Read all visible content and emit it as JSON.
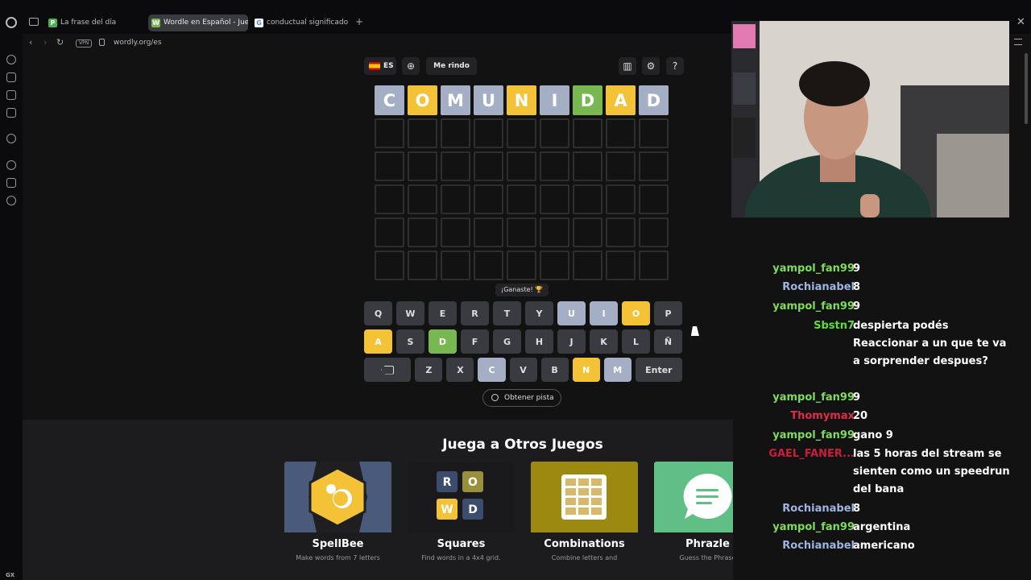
{
  "browser": {
    "tabs": [
      {
        "label": "La frase del día",
        "favicon": "P",
        "favicon_color": "#4caf50"
      },
      {
        "label": "Wordle en Español - Juego",
        "favicon": "W",
        "favicon_color": "#79b851"
      },
      {
        "label": "conductual significado - B",
        "favicon": "G",
        "favicon_color": "#ea4335"
      }
    ],
    "url": "wordly.org/es",
    "vpn_label": "VPN"
  },
  "toolbar": {
    "language": "ES",
    "give_up_label": "Me rindo"
  },
  "board": {
    "rows": [
      [
        {
          "l": "C",
          "s": "absent"
        },
        {
          "l": "O",
          "s": "present"
        },
        {
          "l": "M",
          "s": "absent"
        },
        {
          "l": "U",
          "s": "absent"
        },
        {
          "l": "N",
          "s": "present"
        },
        {
          "l": "I",
          "s": "absent"
        },
        {
          "l": "D",
          "s": "correct"
        },
        {
          "l": "A",
          "s": "present"
        },
        {
          "l": "D",
          "s": "absent"
        }
      ],
      [
        {
          "l": "",
          "s": ""
        },
        {
          "l": "",
          "s": ""
        },
        {
          "l": "",
          "s": ""
        },
        {
          "l": "",
          "s": ""
        },
        {
          "l": "",
          "s": ""
        },
        {
          "l": "",
          "s": ""
        },
        {
          "l": "",
          "s": ""
        },
        {
          "l": "",
          "s": ""
        },
        {
          "l": "",
          "s": ""
        }
      ],
      [
        {
          "l": "",
          "s": ""
        },
        {
          "l": "",
          "s": ""
        },
        {
          "l": "",
          "s": ""
        },
        {
          "l": "",
          "s": ""
        },
        {
          "l": "",
          "s": ""
        },
        {
          "l": "",
          "s": ""
        },
        {
          "l": "",
          "s": ""
        },
        {
          "l": "",
          "s": ""
        },
        {
          "l": "",
          "s": ""
        }
      ],
      [
        {
          "l": "",
          "s": ""
        },
        {
          "l": "",
          "s": ""
        },
        {
          "l": "",
          "s": ""
        },
        {
          "l": "",
          "s": ""
        },
        {
          "l": "",
          "s": ""
        },
        {
          "l": "",
          "s": ""
        },
        {
          "l": "",
          "s": ""
        },
        {
          "l": "",
          "s": ""
        },
        {
          "l": "",
          "s": ""
        }
      ],
      [
        {
          "l": "",
          "s": ""
        },
        {
          "l": "",
          "s": ""
        },
        {
          "l": "",
          "s": ""
        },
        {
          "l": "",
          "s": ""
        },
        {
          "l": "",
          "s": ""
        },
        {
          "l": "",
          "s": ""
        },
        {
          "l": "",
          "s": ""
        },
        {
          "l": "",
          "s": ""
        },
        {
          "l": "",
          "s": ""
        }
      ],
      [
        {
          "l": "",
          "s": ""
        },
        {
          "l": "",
          "s": ""
        },
        {
          "l": "",
          "s": ""
        },
        {
          "l": "",
          "s": ""
        },
        {
          "l": "",
          "s": ""
        },
        {
          "l": "",
          "s": ""
        },
        {
          "l": "",
          "s": ""
        },
        {
          "l": "",
          "s": ""
        },
        {
          "l": "",
          "s": ""
        }
      ]
    ]
  },
  "toast": "¡Ganaste! 🏆",
  "keyboard": {
    "rows": [
      [
        {
          "k": "Q"
        },
        {
          "k": "W"
        },
        {
          "k": "E"
        },
        {
          "k": "R"
        },
        {
          "k": "T"
        },
        {
          "k": "Y"
        },
        {
          "k": "U",
          "s": "absent"
        },
        {
          "k": "I",
          "s": "absent"
        },
        {
          "k": "O",
          "s": "present"
        },
        {
          "k": "P"
        }
      ],
      [
        {
          "k": "A",
          "s": "present"
        },
        {
          "k": "S"
        },
        {
          "k": "D",
          "s": "correct"
        },
        {
          "k": "F"
        },
        {
          "k": "G"
        },
        {
          "k": "H"
        },
        {
          "k": "J"
        },
        {
          "k": "K"
        },
        {
          "k": "L"
        },
        {
          "k": "Ñ"
        }
      ],
      [
        {
          "k": "⌫",
          "wide": true,
          "backspace": true
        },
        {
          "k": "Z"
        },
        {
          "k": "X"
        },
        {
          "k": "C",
          "s": "absent"
        },
        {
          "k": "V"
        },
        {
          "k": "B"
        },
        {
          "k": "N",
          "s": "present"
        },
        {
          "k": "M",
          "s": "absent"
        },
        {
          "k": "Enter",
          "wide": true
        }
      ]
    ]
  },
  "hint_label": "Obtener pista",
  "others": {
    "title": "Juega a Otros Juegos",
    "games": [
      {
        "name": "SpellBee",
        "desc": "Make words from 7 letters"
      },
      {
        "name": "Squares",
        "desc": "Find words in a 4x4 grid."
      },
      {
        "name": "Combinations",
        "desc": "Combine letters and"
      },
      {
        "name": "Phrazle",
        "desc": "Guess the Phrase"
      }
    ]
  },
  "chat": [
    {
      "user": "yampol_fan99",
      "color": "#7fdb5a",
      "text": "9"
    },
    {
      "user": "Rochianabel",
      "color": "#9fb4e0",
      "text": "8"
    },
    {
      "user": "yampol_fan99",
      "color": "#7fdb5a",
      "text": "9"
    },
    {
      "user": "Sbstn7",
      "color": "#5ddc3c",
      "text": "despierta podés Reaccionar a un que te va a sorprender despues?"
    },
    {
      "user": "yampol_fan99",
      "color": "#7fdb5a",
      "text": "9"
    },
    {
      "user": "Thomymax",
      "color": "#d9304a",
      "text": "20"
    },
    {
      "user": "yampol_fan99",
      "color": "#7fdb5a",
      "text": "gano 9"
    },
    {
      "user": "GAEL_FANER...",
      "color": "#c81e3c",
      "text": "las 5 horas del stream se sienten como un speedrun del bana"
    },
    {
      "user": "Rochianabel",
      "color": "#9fb4e0",
      "text": "8"
    },
    {
      "user": "yampol_fan99",
      "color": "#7fdb5a",
      "text": "argentina"
    },
    {
      "user": "Rochianabel",
      "color": "#9fb4e0",
      "text": "americano"
    }
  ],
  "colors": {
    "correct": "#79b851",
    "present": "#f3c237",
    "absent": "#a4aec4"
  }
}
